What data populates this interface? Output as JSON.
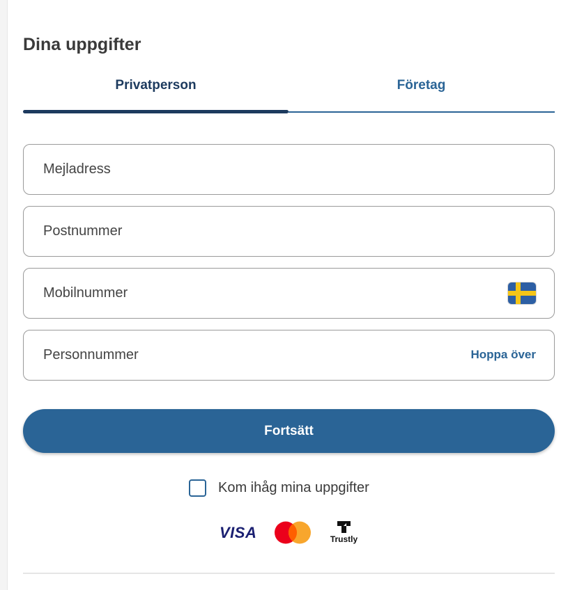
{
  "form": {
    "title": "Dina uppgifter",
    "tabs": [
      {
        "label": "Privatperson",
        "active": true
      },
      {
        "label": "Företag",
        "active": false
      }
    ],
    "fields": {
      "email": {
        "placeholder": "Mejladress",
        "value": ""
      },
      "postal_code": {
        "placeholder": "Postnummer",
        "value": ""
      },
      "mobile": {
        "placeholder": "Mobilnummer",
        "value": "",
        "flag_icon": "sweden-flag-icon"
      },
      "personal_number": {
        "placeholder": "Personnummer",
        "value": "",
        "skip_link": "Hoppa över"
      }
    },
    "continue_label": "Fortsätt",
    "remember": {
      "label": "Kom ihåg mina uppgifter",
      "checked": false
    }
  },
  "payment_logos": {
    "visa": "VISA",
    "mastercard_icon": "mastercard-icon",
    "trustly": "Trustly"
  },
  "colors": {
    "primary": "#2a6496",
    "active_tab": "#1c3a5e",
    "border": "#9a9a9a"
  }
}
